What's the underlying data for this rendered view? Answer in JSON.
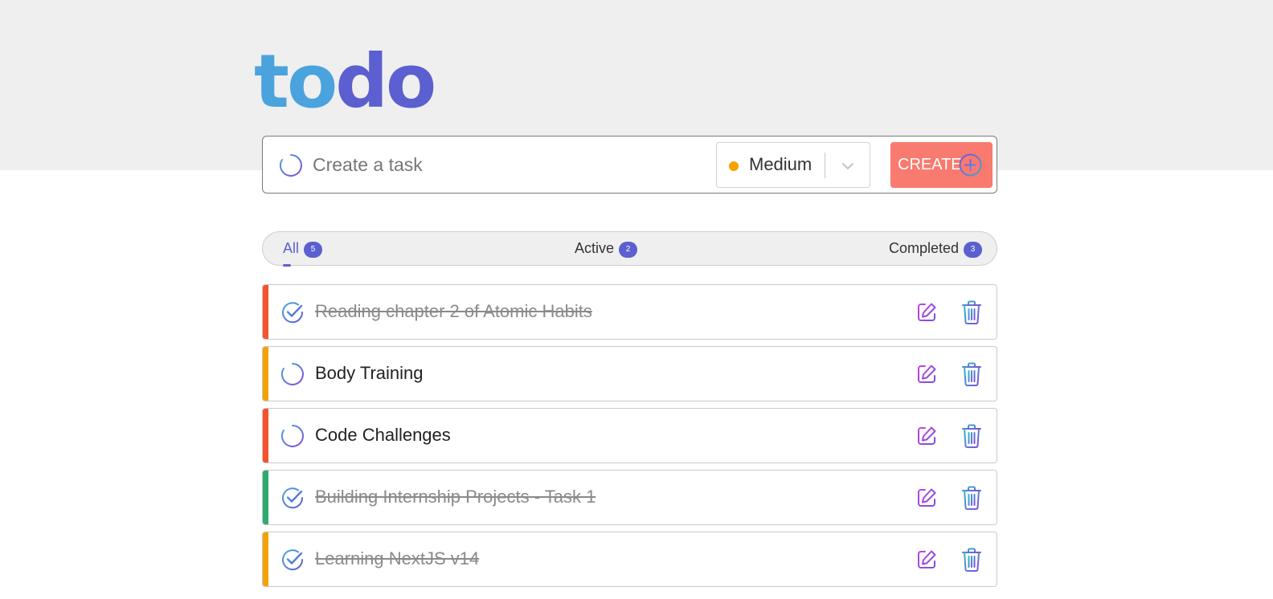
{
  "logo": {
    "part1": "to",
    "part2": "do"
  },
  "create": {
    "placeholder": "Create a task",
    "priority_label": "Medium",
    "priority_color": "#f5a100",
    "button_label": "CREATE"
  },
  "filters": {
    "all_label": "All",
    "all_count": "5",
    "active_label": "Active",
    "active_count": "2",
    "completed_label": "Completed",
    "completed_count": "3",
    "selected": "All"
  },
  "colors": {
    "accent": "#5b5fcf",
    "logo_light": "#4aa3dd",
    "create_button": "#f97a6e",
    "priority_high": "#f5532d",
    "priority_medium": "#f5a100",
    "priority_low": "#2dab6f"
  },
  "tasks": [
    {
      "title": "Reading chapter 2 of Atomic Habits",
      "completed": true,
      "priority": "high",
      "icon": "check-circle-icon"
    },
    {
      "title": "Body Training",
      "completed": false,
      "priority": "medium",
      "icon": "spinner-icon"
    },
    {
      "title": "Code Challenges",
      "completed": false,
      "priority": "high",
      "icon": "spinner-icon"
    },
    {
      "title": "Building Internship Projects - Task 1",
      "completed": true,
      "priority": "low",
      "icon": "check-circle-icon"
    },
    {
      "title": "Learning NextJS v14",
      "completed": true,
      "priority": "medium",
      "icon": "check-circle-icon"
    }
  ]
}
